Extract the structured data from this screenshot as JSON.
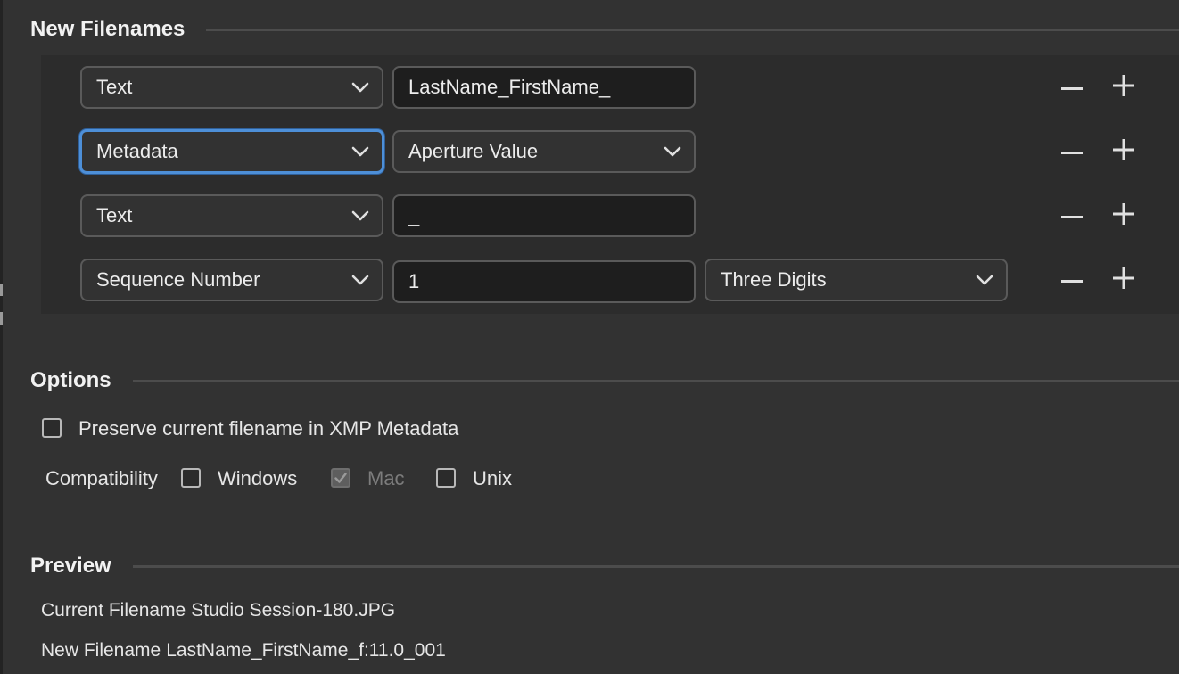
{
  "sections": {
    "new_filenames": "New Filenames",
    "options": "Options",
    "preview": "Preview"
  },
  "rows": [
    {
      "type": "Text",
      "value": "LastName_FirstName_"
    },
    {
      "type": "Metadata",
      "field": "Aperture Value"
    },
    {
      "type": "Text",
      "value": "_"
    },
    {
      "type": "Sequence Number",
      "value": "1",
      "digits": "Three Digits"
    }
  ],
  "options": {
    "preserve_label": "Preserve current filename in XMP Metadata",
    "preserve_checked": false,
    "compatibility_label": "Compatibility",
    "windows_label": "Windows",
    "windows_checked": false,
    "mac_label": "Mac",
    "mac_checked": true,
    "unix_label": "Unix",
    "unix_checked": false
  },
  "preview": {
    "current_label": "Current Filename",
    "current_value": "Studio Session-180.JPG",
    "new_label": "New Filename",
    "new_value": "LastName_FirstName_f:11.0_001"
  },
  "icons": {
    "dropdown": "chevron-down-icon",
    "remove": "minus-icon",
    "add": "plus-icon",
    "check": "checkmark-icon"
  },
  "colors": {
    "background": "#323232",
    "panel": "#2c2c2c",
    "focus": "#4d8fd8",
    "field": "#1e1e1e"
  }
}
